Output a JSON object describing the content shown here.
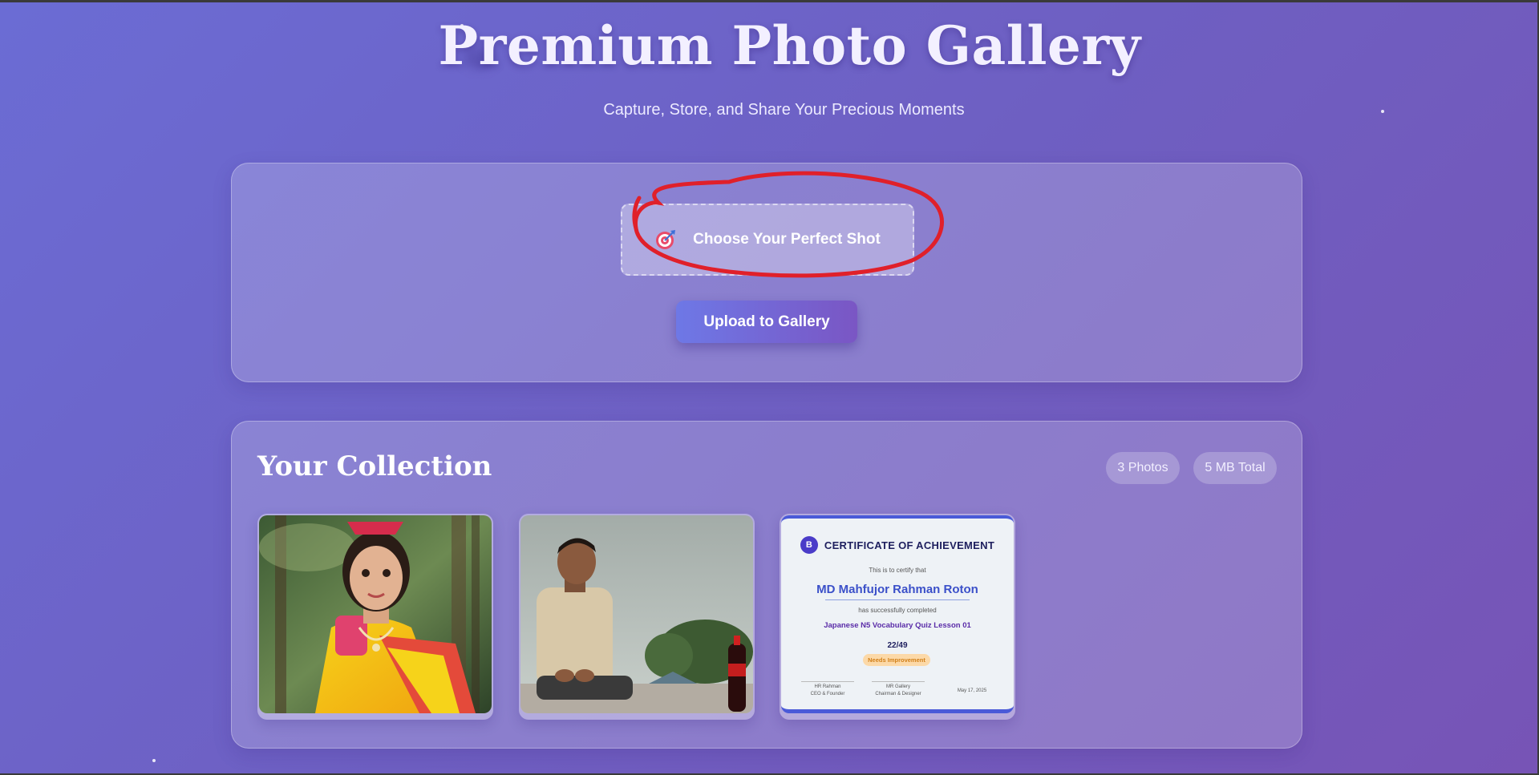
{
  "header": {
    "title": "Premium Photo Gallery",
    "subtitle": "Capture, Store, and Share Your Precious Moments"
  },
  "upload": {
    "choose_label": "Choose Your Perfect Shot",
    "choose_icon": "target-icon",
    "upload_button_label": "Upload to Gallery",
    "annotation_color": "#e0202a"
  },
  "collection": {
    "title": "Your Collection",
    "photo_count": "3 Photos",
    "total_size": "5 MB Total",
    "photos": [
      {
        "subject": "girl-in-yellow-saree-photo"
      },
      {
        "subject": "man-seated-outdoors-photo"
      },
      {
        "subject": "certificate-photo",
        "certificate": {
          "logo_letter": "B",
          "title": "CERTIFICATE OF ACHIEVEMENT",
          "line1": "This is to certify that",
          "name": "MD Mahfujor Rahman Roton",
          "line2": "has successfully completed",
          "course": "Japanese N5 Vocabulary Quiz Lesson 01",
          "score": "22/49",
          "status": "Needs Improvement",
          "sig1_name": "HR Rahman",
          "sig1_role": "CEO & Founder",
          "sig2_name": "MR Gallery",
          "sig2_role": "Chairman & Designer",
          "date": "May 17, 2025"
        }
      }
    ]
  },
  "colors": {
    "background_start": "#6b6cd4",
    "background_end": "#7754b6",
    "button_start": "#6e78e6",
    "button_end": "#7a56c4"
  }
}
